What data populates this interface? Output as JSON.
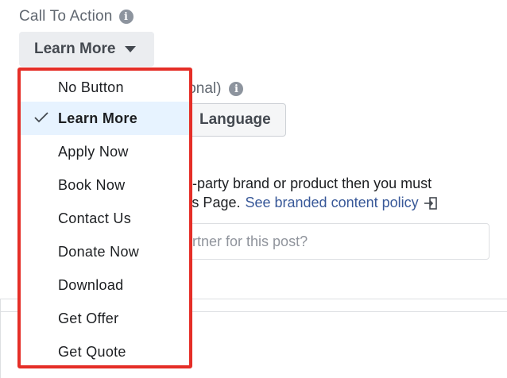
{
  "cta": {
    "label": "Call To Action",
    "selected": "Learn More"
  },
  "background": {
    "label_partial": "ional)",
    "language_button": "Language"
  },
  "branded_content": {
    "line1": "d-party brand or product then you must",
    "line2_prefix": "r's Page.",
    "policy_link": "See branded content policy",
    "partner_placeholder": "artner for this post?"
  },
  "dropdown": {
    "items": [
      {
        "label": "No Button",
        "selected": false
      },
      {
        "label": "Learn More",
        "selected": true
      },
      {
        "label": "Apply Now",
        "selected": false
      },
      {
        "label": "Book Now",
        "selected": false
      },
      {
        "label": "Contact Us",
        "selected": false
      },
      {
        "label": "Donate Now",
        "selected": false
      },
      {
        "label": "Download",
        "selected": false
      },
      {
        "label": "Get Offer",
        "selected": false
      },
      {
        "label": "Get Quote",
        "selected": false
      }
    ]
  },
  "colors": {
    "highlight_border": "#e52e27",
    "selected_bg": "#e7f3ff",
    "link": "#385898"
  },
  "icons": [
    "info-icon",
    "caret-down-icon",
    "checkmark-icon",
    "exit-icon"
  ]
}
